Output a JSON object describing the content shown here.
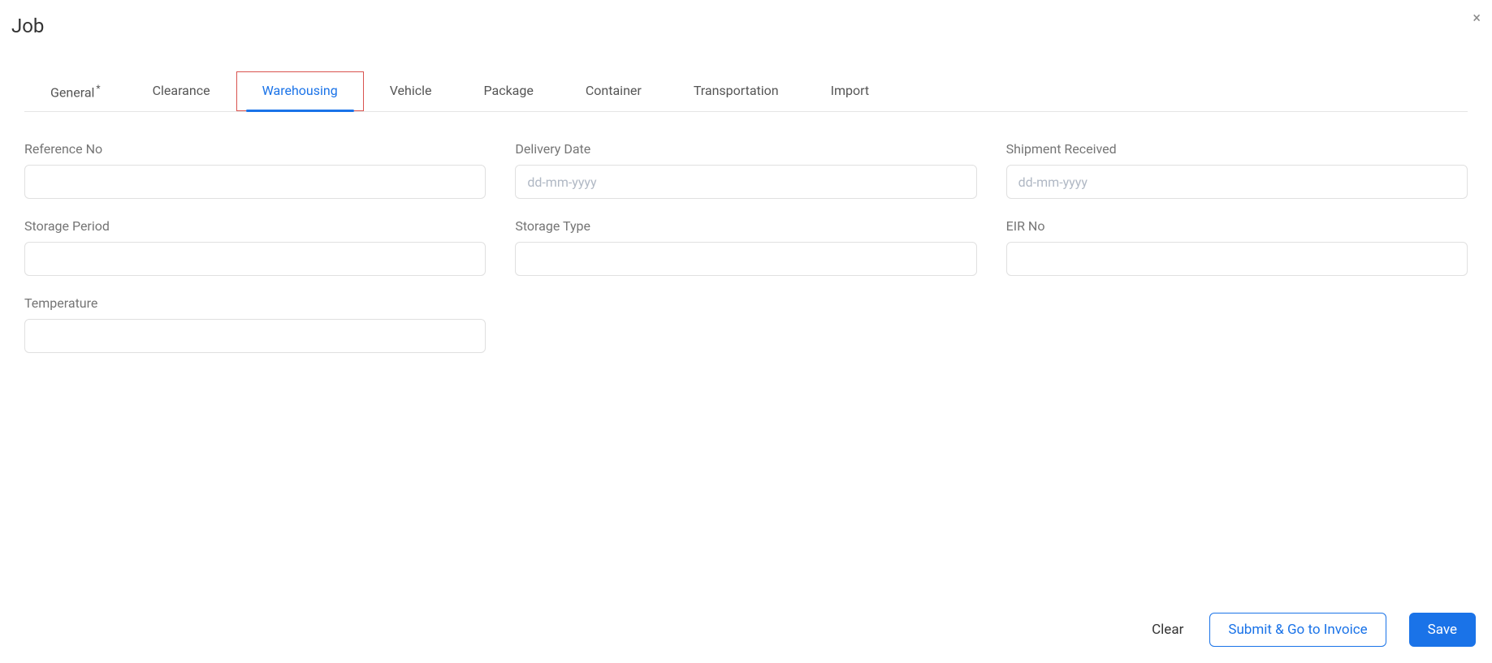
{
  "title": "Job",
  "tabs": [
    {
      "label": "General",
      "required": true,
      "active": false
    },
    {
      "label": "Clearance",
      "required": false,
      "active": false
    },
    {
      "label": "Warehousing",
      "required": false,
      "active": true
    },
    {
      "label": "Vehicle",
      "required": false,
      "active": false
    },
    {
      "label": "Package",
      "required": false,
      "active": false
    },
    {
      "label": "Container",
      "required": false,
      "active": false
    },
    {
      "label": "Transportation",
      "required": false,
      "active": false
    },
    {
      "label": "Import",
      "required": false,
      "active": false
    }
  ],
  "fields": {
    "reference_no": {
      "label": "Reference No",
      "value": "",
      "placeholder": ""
    },
    "delivery_date": {
      "label": "Delivery Date",
      "value": "",
      "placeholder": "dd-mm-yyyy"
    },
    "shipment_received": {
      "label": "Shipment Received",
      "value": "",
      "placeholder": "dd-mm-yyyy"
    },
    "storage_period": {
      "label": "Storage Period",
      "value": "",
      "placeholder": ""
    },
    "storage_type": {
      "label": "Storage Type",
      "value": "",
      "placeholder": ""
    },
    "eir_no": {
      "label": "EIR No",
      "value": "",
      "placeholder": ""
    },
    "temperature": {
      "label": "Temperature",
      "value": "",
      "placeholder": ""
    }
  },
  "footer": {
    "clear": "Clear",
    "submit_invoice": "Submit & Go to Invoice",
    "save": "Save"
  },
  "close_symbol": "×"
}
